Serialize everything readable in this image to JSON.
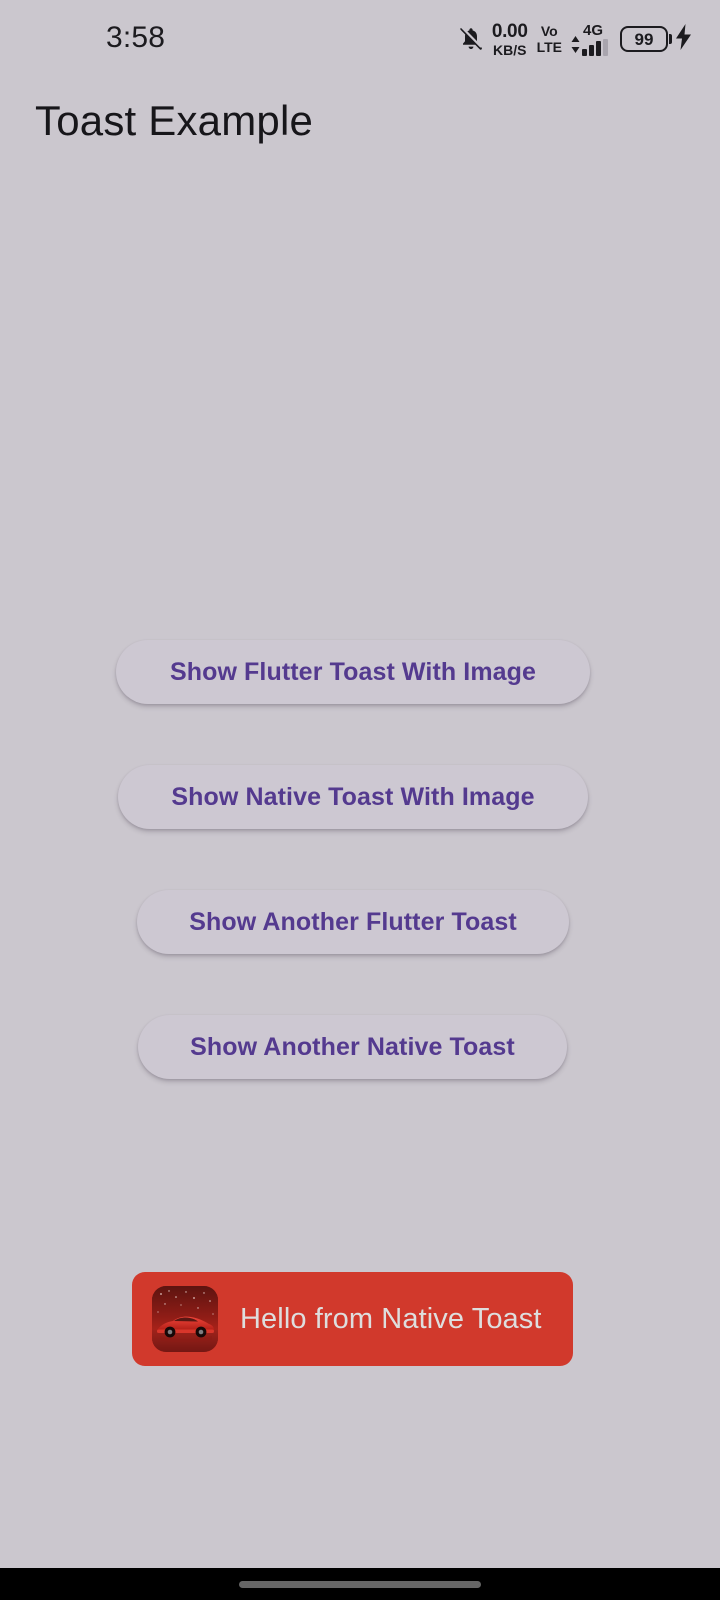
{
  "status_bar": {
    "time": "3:58",
    "mute_icon": "bell-muted-icon",
    "network_speed_value": "0.00",
    "network_speed_unit": "KB/S",
    "volte_top": "Vo",
    "volte_bottom": "LTE",
    "network_generation": "4G",
    "signal_bars_filled": 3,
    "signal_bars_total": 4,
    "battery_level": "99",
    "charging_icon": "lightning-bolt-icon",
    "data_arrows_icon": "up-down-arrows-icon"
  },
  "app": {
    "title": "Toast Example"
  },
  "buttons": [
    {
      "label": "Show Flutter Toast With Image",
      "name": "show-flutter-toast-with-image-button"
    },
    {
      "label": "Show Native Toast With Image",
      "name": "show-native-toast-with-image-button"
    },
    {
      "label": "Show Another Flutter Toast",
      "name": "show-another-flutter-toast-button"
    },
    {
      "label": "Show Another Native Toast",
      "name": "show-another-native-toast-button"
    }
  ],
  "toast": {
    "message": "Hello from Native Toast",
    "thumbnail_icon": "red-sports-car-image",
    "background_color": "#d1392c",
    "text_color": "#dedede"
  },
  "nav_bar": {
    "gesture_handle": "home-gesture-pill"
  },
  "theme": {
    "page_background": "#cbc7ce",
    "button_background": "#cdc8d2",
    "button_text_color": "#543a8f",
    "title_color": "#17161a",
    "status_icon_color": "#1c1b1f",
    "nav_bar_color": "#000000"
  }
}
